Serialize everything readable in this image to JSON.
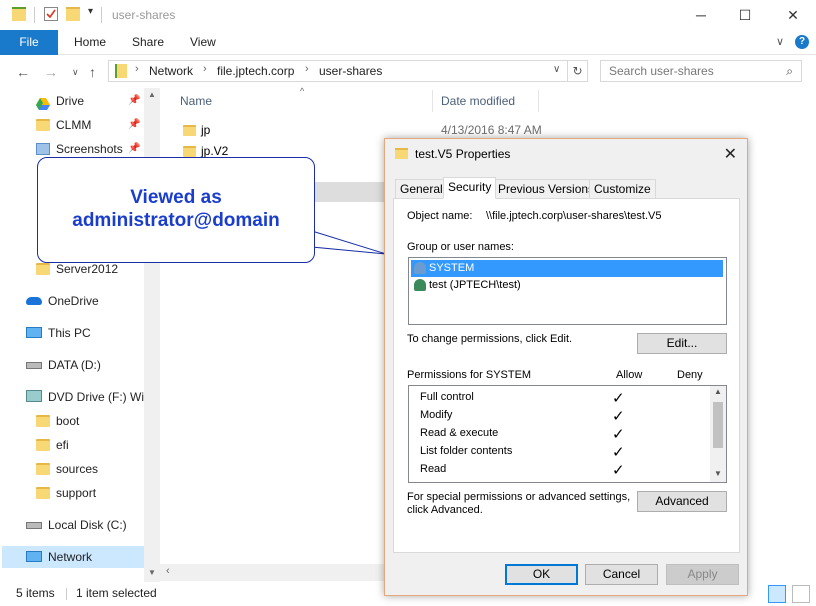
{
  "window": {
    "title": "user-shares",
    "controls": {
      "minimize": "─",
      "maximize": "☐",
      "close": "✕"
    }
  },
  "ribbon": {
    "tabs": [
      "File",
      "Home",
      "Share",
      "View"
    ],
    "expand": "∨",
    "help": "?"
  },
  "address": {
    "crumbs": [
      "Network",
      "file.jptech.corp",
      "user-shares"
    ],
    "search_placeholder": "Search user-shares"
  },
  "sidebar": {
    "items": [
      {
        "label": "Drive",
        "icon": "google-drive-icon",
        "pinned": true
      },
      {
        "label": "CLMM",
        "icon": "folder-check-icon",
        "pinned": true
      },
      {
        "label": "Screenshots",
        "icon": "screenshots-folder-icon",
        "pinned": true
      },
      {
        "label": "Server2012",
        "icon": "folder-icon"
      },
      {
        "label": "OneDrive",
        "icon": "onedrive-cloud-icon"
      },
      {
        "label": "This PC",
        "icon": "computer-icon"
      },
      {
        "label": "DATA (D:)",
        "icon": "drive-icon"
      },
      {
        "label": "DVD Drive (F:) Wir",
        "icon": "dvd-drive-icon"
      },
      {
        "label": "boot",
        "icon": "folder-icon"
      },
      {
        "label": "efi",
        "icon": "folder-icon"
      },
      {
        "label": "sources",
        "icon": "folder-icon"
      },
      {
        "label": "support",
        "icon": "folder-icon"
      },
      {
        "label": "Local Disk (C:)",
        "icon": "local-disk-icon"
      },
      {
        "label": "Network",
        "icon": "network-icon",
        "selected": true
      }
    ]
  },
  "filelist": {
    "columns": [
      "Name",
      "Date modified"
    ],
    "rows": [
      {
        "name": "jp",
        "date": "4/13/2016 8:47 AM"
      },
      {
        "name": "jp.V2",
        "date": ""
      }
    ]
  },
  "status": {
    "items": "5 items",
    "selected": "1 item selected"
  },
  "callout": {
    "line1": "Viewed as",
    "line2": "administrator@domain"
  },
  "dialog": {
    "title": "test.V5 Properties",
    "close": "✕",
    "tabs": [
      "General",
      "Security",
      "Previous Versions",
      "Customize"
    ],
    "active_tab": "Security",
    "object_name_label": "Object name:",
    "object_name_value": "\\\\file.jptech.corp\\user-shares\\test.V5",
    "group_label": "Group or user names:",
    "users": [
      {
        "name": "SYSTEM",
        "selected": true
      },
      {
        "name": "test (JPTECH\\test)",
        "selected": false
      }
    ],
    "change_text": "To change permissions, click Edit.",
    "edit_button": "Edit...",
    "permissions_label": "Permissions for SYSTEM",
    "allow_label": "Allow",
    "deny_label": "Deny",
    "permissions": [
      {
        "name": "Full control",
        "allow": true,
        "deny": false
      },
      {
        "name": "Modify",
        "allow": true,
        "deny": false
      },
      {
        "name": "Read & execute",
        "allow": true,
        "deny": false
      },
      {
        "name": "List folder contents",
        "allow": true,
        "deny": false
      },
      {
        "name": "Read",
        "allow": true,
        "deny": false
      }
    ],
    "special_text_1": "For special permissions or advanced settings,",
    "special_text_2": "click Advanced.",
    "advanced_button": "Advanced",
    "ok_button": "OK",
    "cancel_button": "Cancel",
    "apply_button": "Apply",
    "check_glyph": "✓"
  },
  "colors": {
    "accent": "#1979ca",
    "selection": "#3399ff",
    "callout_text": "#1a3dcc"
  }
}
